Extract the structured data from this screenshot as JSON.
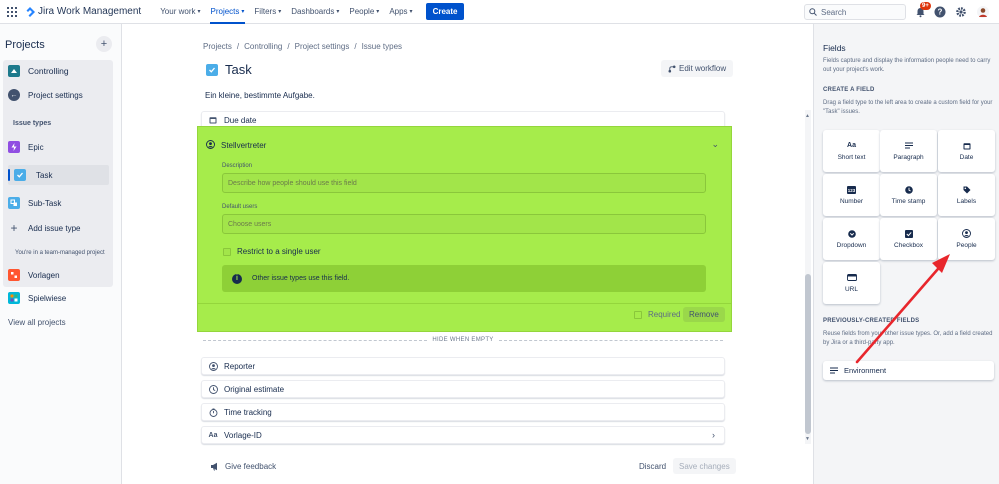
{
  "topbar": {
    "product": "Jira Work Management",
    "nav": [
      "Your work",
      "Projects",
      "Filters",
      "Dashboards",
      "People",
      "Apps"
    ],
    "create": "Create",
    "search_placeholder": "Search",
    "notifications_badge": "9+"
  },
  "sidebar": {
    "title": "Projects",
    "project": "Controlling",
    "project_settings": "Project settings",
    "issue_types_heading": "Issue types",
    "issue_types": [
      "Epic",
      "Task",
      "Sub-Task"
    ],
    "add_issue_type": "Add issue type",
    "team_managed": "You're in a team-managed project",
    "other_projects": [
      "Vorlagen",
      "Spielwiese"
    ],
    "view_all": "View all projects"
  },
  "main": {
    "breadcrumb": [
      "Projects",
      "/",
      "Controlling",
      "/",
      "Project settings",
      "/",
      "Issue types"
    ],
    "title": "Task",
    "edit_workflow": "Edit workflow",
    "description": "Ein kleine, bestimmte Aufgabe.",
    "due_date": "Due date",
    "expanded_field": {
      "name": "Stellvertreter",
      "description_label": "Description",
      "description_placeholder": "Describe how people should use this field",
      "default_users_label": "Default users",
      "default_users_placeholder": "Choose users",
      "restrict": "Restrict to a single user",
      "info": "Other issue types use this field.",
      "required": "Required",
      "remove": "Remove"
    },
    "hide_when_empty": "HIDE WHEN EMPTY",
    "hidden_fields": [
      "Reporter",
      "Original estimate",
      "Time tracking",
      "Vorlage-ID"
    ],
    "feedback": "Give feedback",
    "discard": "Discard",
    "save": "Save changes"
  },
  "rpanel": {
    "title": "Fields",
    "intro": "Fields capture and display the information people need to carry out your project's work.",
    "create_heading": "CREATE A FIELD",
    "create_text": "Drag a field type to the left area to create a custom field for your \"Task\" issues.",
    "tiles": [
      "Short text",
      "Paragraph",
      "Date",
      "Number",
      "Time stamp",
      "Labels",
      "Dropdown",
      "Checkbox",
      "People",
      "URL"
    ],
    "prev_heading": "PREVIOUSLY-CREATED FIELDS",
    "prev_text": "Reuse fields from your other issue types. Or, add a field created by Jira or a third-party app.",
    "env": "Environment"
  },
  "colors": {
    "highlight": "#a6ec4b",
    "accent": "#0052cc",
    "arrow": "#e8262c"
  }
}
